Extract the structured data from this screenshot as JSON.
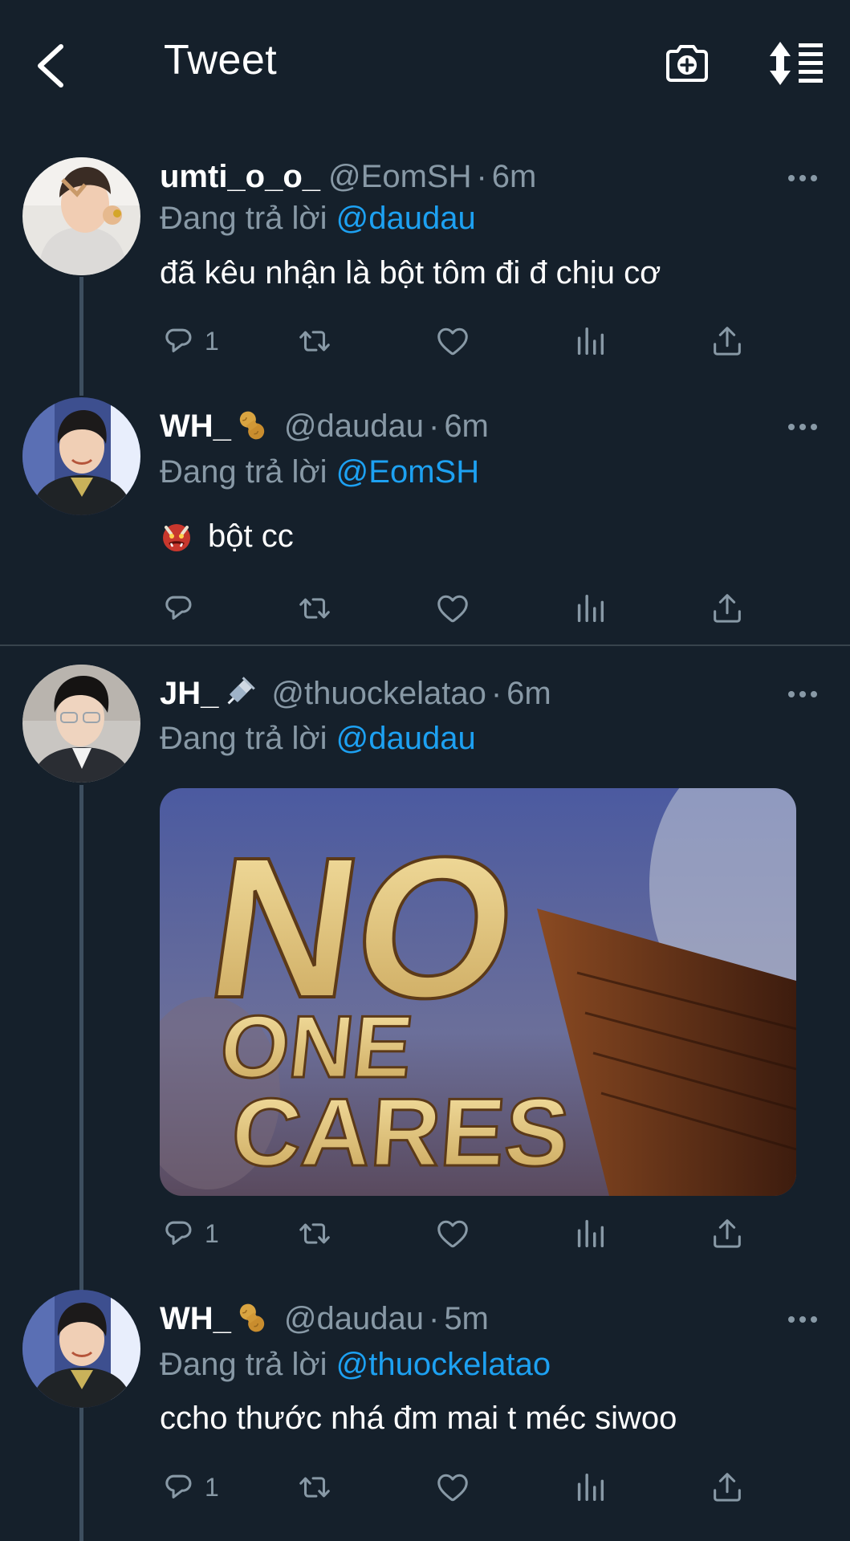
{
  "header": {
    "title": "Tweet",
    "back_icon": "chevron-left-icon",
    "camera_icon": "camera-plus-icon",
    "sort_icon": "sort-icon"
  },
  "colors": {
    "background": "#15202b",
    "secondary_text": "#8899a6",
    "mention": "#1da1f2",
    "thread_line": "#3d4e5f"
  },
  "tweets": [
    {
      "name": "umti_o_o_",
      "handle": "@EomSH",
      "separator": "·",
      "time": "6m",
      "reply_prefix": "Đang trả lời",
      "reply_to": "@daudau",
      "text": "đã kêu nhận là bột tôm đi đ chịu cơ",
      "reply_count": "1"
    },
    {
      "name": "WH_",
      "badge_icon": "peanut-icon",
      "handle": "@daudau",
      "separator": "·",
      "time": "6m",
      "reply_prefix": "Đang trả lời",
      "reply_to": "@EomSH",
      "text": "bột cc",
      "emoji": "ogre-icon",
      "reply_count": ""
    },
    {
      "name": "JH_",
      "badge_icon": "syringe-icon",
      "handle": "@thuockelatao",
      "separator": "·",
      "time": "6m",
      "reply_prefix": "Đang trả lời",
      "reply_to": "@daudau",
      "media_text_1": "NO",
      "media_text_2": "ONE",
      "media_text_3": "CARES",
      "reply_count": "1"
    },
    {
      "name": "WH_",
      "badge_icon": "peanut-icon",
      "handle": "@daudau",
      "separator": "·",
      "time": "5m",
      "reply_prefix": "Đang trả lời",
      "reply_to": "@thuockelatao",
      "text": "ccho thước nhá đm mai t méc siwoo",
      "reply_count": "1"
    }
  ]
}
